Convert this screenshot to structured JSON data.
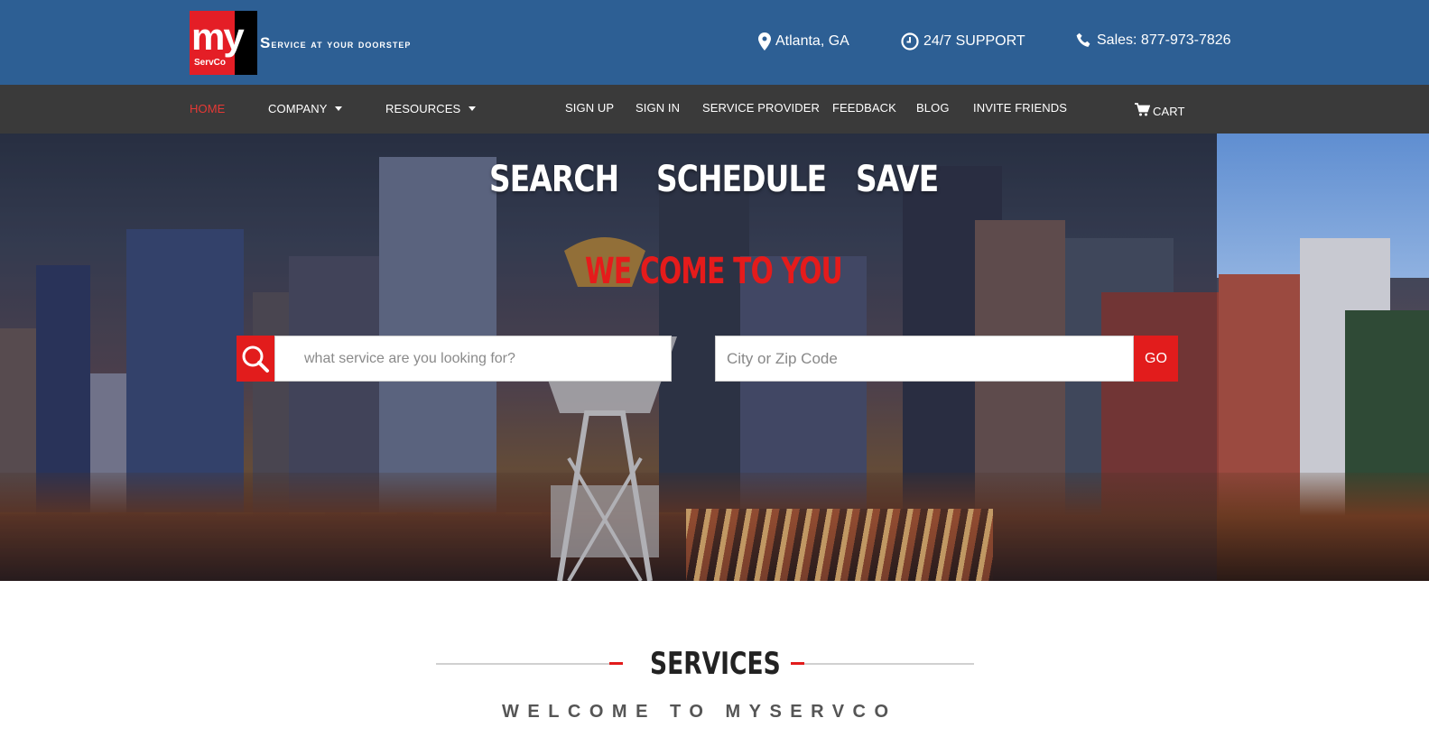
{
  "header": {
    "logo_text": "my",
    "logo_subtext": "ServCo",
    "tagline_first": "S",
    "tagline_rest": "ervice at your doorstep",
    "location": "Atlanta, GA",
    "support": "24/7 SUPPORT",
    "sales": "Sales: 877-973-7826",
    "icons": {
      "location": "map-pin-icon",
      "support": "clock-icon",
      "sales": "phone-icon"
    }
  },
  "nav": {
    "home": "HOME",
    "company": "COMPANY",
    "resources": "RESOURCES",
    "signup": "SIGN UP",
    "signin": "SIGN IN",
    "service_provider": "SERVICE PROVIDER",
    "feedback": "FEEDBACK",
    "blog": "BLOG",
    "invite": "INVITE FRIENDS",
    "cart": "CART",
    "active_color": "#e53935"
  },
  "hero": {
    "word1": "SEARCH",
    "word2": "SCHEDULE",
    "word3": "SAVE",
    "subtitle": "WE COME TO YOU",
    "search_placeholder": "what service are you looking for?",
    "city_placeholder": "City or Zip Code",
    "go_label": "GO"
  },
  "services": {
    "title": "SERVICES",
    "subtitle": "WELCOME TO MYSERVCO"
  },
  "colors": {
    "header_bg": "#2d5f94",
    "nav_bg": "#3a3a3a",
    "accent": "#e21c1c"
  }
}
